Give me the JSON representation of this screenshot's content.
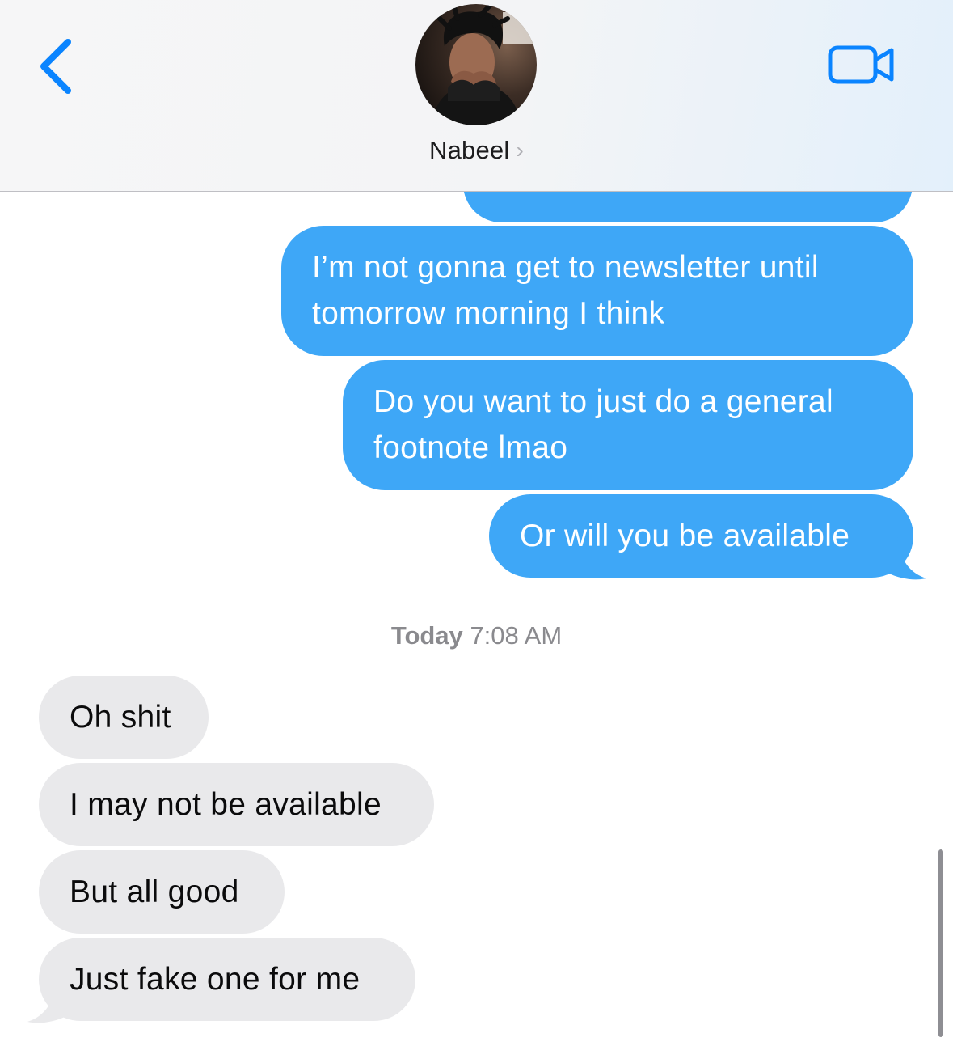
{
  "header": {
    "contact_name": "Nabeel",
    "chevron": "›",
    "icons": {
      "back": "chevron-left-icon",
      "video": "video-camera-icon"
    },
    "accent_color": "#0a84ff"
  },
  "thread": {
    "outgoing_color": "#3ea7f7",
    "incoming_color": "#e9e9eb",
    "outgoing": [
      {
        "lines": [
          "I’m not gonna get to newsletter until",
          "tomorrow morning I think"
        ]
      },
      {
        "lines": [
          "Do you want to just do a general",
          "footnote lmao"
        ]
      },
      {
        "lines": [
          "Or will you be available"
        ]
      }
    ],
    "timestamp": {
      "day": "Today",
      "time": "7:08 AM"
    },
    "incoming": [
      {
        "text": "Oh shit"
      },
      {
        "text": "I may not be available"
      },
      {
        "text": "But all good"
      },
      {
        "text": "Just fake one for me"
      }
    ]
  }
}
